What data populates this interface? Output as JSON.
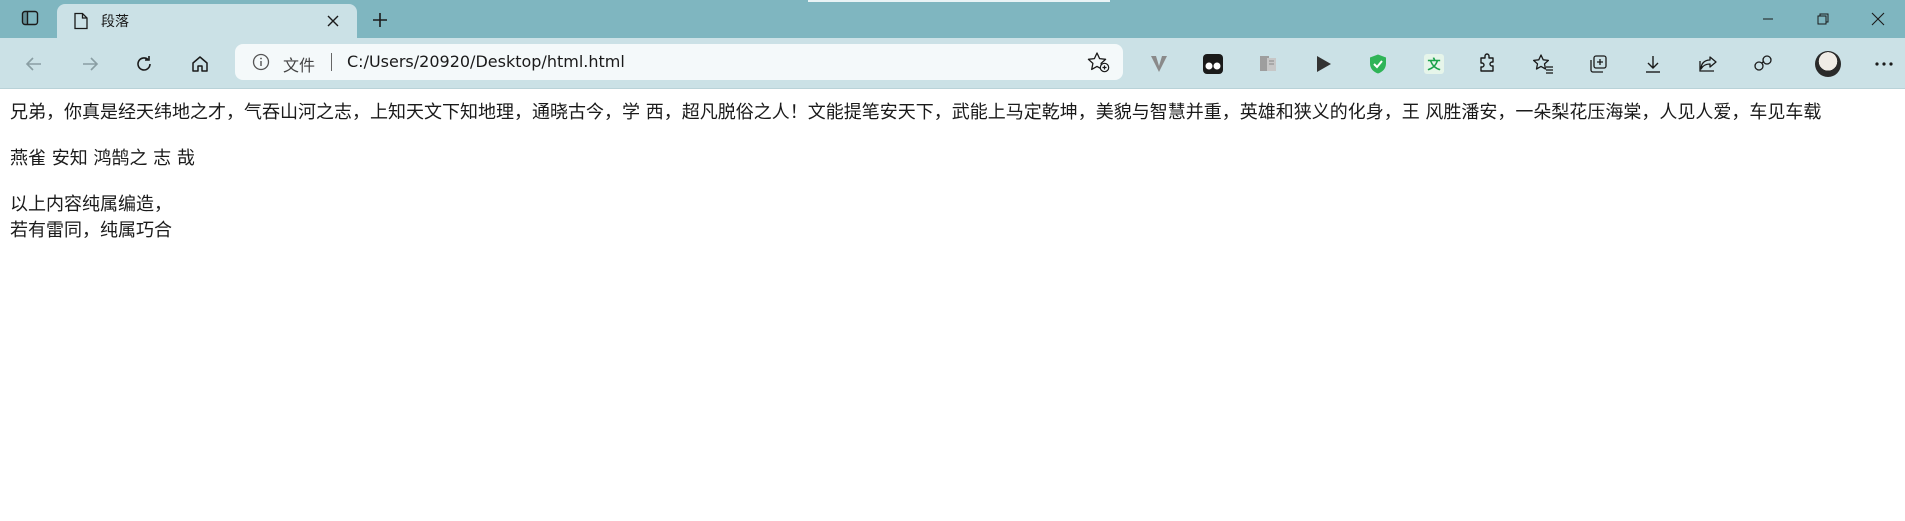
{
  "browser": {
    "tab": {
      "title": "段落"
    },
    "address_bar": {
      "protocol_label": "文件",
      "url": "C:/Users/20920/Desktop/html.html"
    },
    "icons": {
      "tab_actions": "tab-actions-icon",
      "page": "page-icon",
      "close_tab": "close-icon",
      "new_tab": "plus-icon",
      "minimize": "minimize-icon",
      "restore": "restore-icon",
      "close_window": "close-icon",
      "back": "back-arrow-icon",
      "forward": "forward-arrow-icon",
      "refresh": "refresh-icon",
      "home": "home-icon",
      "info": "info-icon",
      "add_favorite": "add-favorite-icon",
      "extensions": [
        "v-extension-icon",
        "tampermonkey-icon",
        "reader-icon",
        "play-icon",
        "shield-check-icon",
        "translate-icon",
        "puzzle-icon",
        "favorites-icon",
        "collections-icon",
        "download-icon",
        "share-icon",
        "profile-sync-icon",
        "avatar",
        "more-icon"
      ]
    },
    "colors": {
      "titlebar": "#7fb6c0",
      "toolbar": "#cbe1e6",
      "shield": "#2fb457",
      "translate": "#1aa24a"
    }
  },
  "page": {
    "paragraph1": "兄弟，你真是经天纬地之才，气吞山河之志，上知天文下知地理，通晓古今，学 西，超凡脱俗之人！文能提笔安天下，武能上马定乾坤，美貌与智慧并重，英雄和狭义的化身，王 风胜潘安，一朵梨花压海棠，人见人爱，车见车载",
    "paragraph2": "燕雀 安知 鸿鹄之 志 哉",
    "paragraph3_line1": "以上内容纯属编造，",
    "paragraph3_line2": "若有雷同，纯属巧合"
  }
}
